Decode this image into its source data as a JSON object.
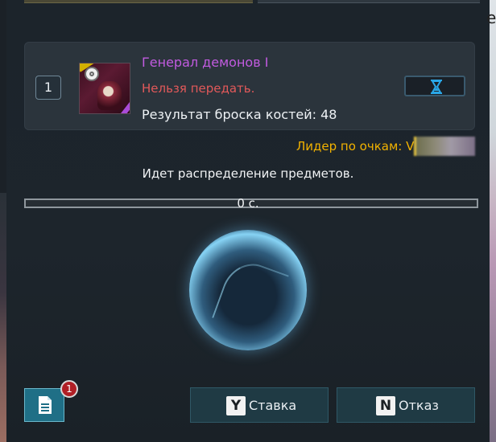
{
  "item": {
    "index": "1",
    "name": "Генерал демонов I",
    "note": "Нельзя передать.",
    "roll_text": "Результат броска костей: 48"
  },
  "leader_label": "Лидер по очкам: V",
  "status_text": "Идет распределение предметов.",
  "progress": {
    "text": "0 с.",
    "fraction": 0
  },
  "notifications": {
    "count": "1",
    "icon": "document-icon"
  },
  "buttons": {
    "bid": {
      "key": "Y",
      "label": "Ставка"
    },
    "pass": {
      "key": "N",
      "label": "Отказ"
    }
  },
  "right_edge_glyph": "e",
  "colors": {
    "item_name": "#c25be0",
    "item_note": "#e2595a",
    "leader": "#f2b200",
    "accent_button": "#1f6f86",
    "badge": "#b01f25"
  }
}
